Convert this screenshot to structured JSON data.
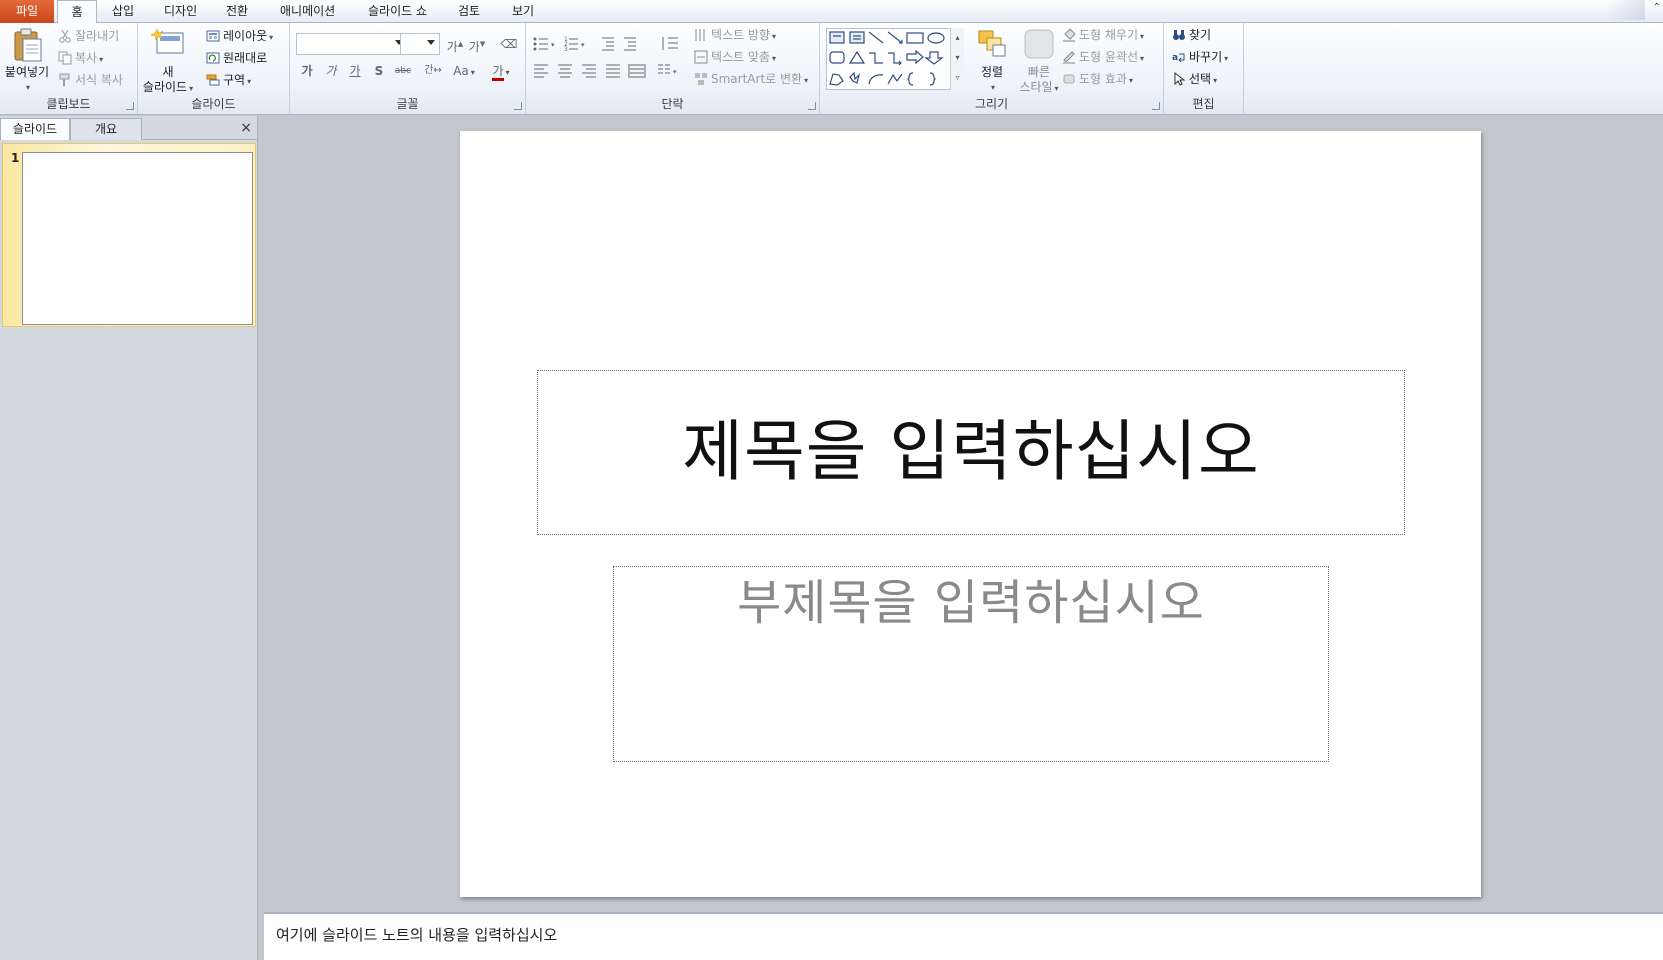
{
  "tabs": [
    {
      "label": "파일"
    },
    {
      "label": "홈"
    },
    {
      "label": "삽입"
    },
    {
      "label": "디자인"
    },
    {
      "label": "전환"
    },
    {
      "label": "애니메이션"
    },
    {
      "label": "슬라이드 쇼"
    },
    {
      "label": "검토"
    },
    {
      "label": "보기"
    }
  ],
  "ribbon": {
    "clipboard": {
      "label": "클립보드",
      "paste": "붙여넣기",
      "cut": "잘라내기",
      "copy": "복사",
      "format_painter": "서식 복사"
    },
    "slides": {
      "label": "슬라이드",
      "new_slide_line1": "새",
      "new_slide_line2": "슬라이드",
      "layout": "레이아웃",
      "reset": "원래대로",
      "section": "구역"
    },
    "font": {
      "label": "글꼴",
      "bold": "가",
      "italic": "가",
      "underline": "가",
      "shadow": "S",
      "strike": "abc",
      "spacing": "간↔",
      "case": "Aa",
      "color": "가"
    },
    "paragraph": {
      "label": "단락",
      "text_direction": "텍스트 방향",
      "align_text": "텍스트 맞춤",
      "smartart": "SmartArt로 변환"
    },
    "drawing": {
      "label": "그리기",
      "arrange": "정렬",
      "quick_styles_line1": "빠른",
      "quick_styles_line2": "스타일",
      "shape_fill": "도형 채우기",
      "shape_outline": "도형 윤곽선",
      "shape_effects": "도형 효과"
    },
    "editing": {
      "label": "편집",
      "find": "찾기",
      "replace": "바꾸기",
      "select": "선택"
    }
  },
  "left_pane": {
    "tab_slides": "슬라이드",
    "tab_outline": "개요",
    "close": "×",
    "slide_number": "1"
  },
  "slide": {
    "title_placeholder": "제목을 입력하십시오",
    "subtitle_placeholder": "부제목을 입력하십시오"
  },
  "notes": {
    "placeholder": "여기에 슬라이드 노트의 내용을 입력하십시오"
  },
  "colors": {
    "file_tab": "#d4531f",
    "ribbon_bg": "#eef3f9",
    "workspace": "#c3c8cf",
    "selected_thumb": "#fbe7a1"
  }
}
